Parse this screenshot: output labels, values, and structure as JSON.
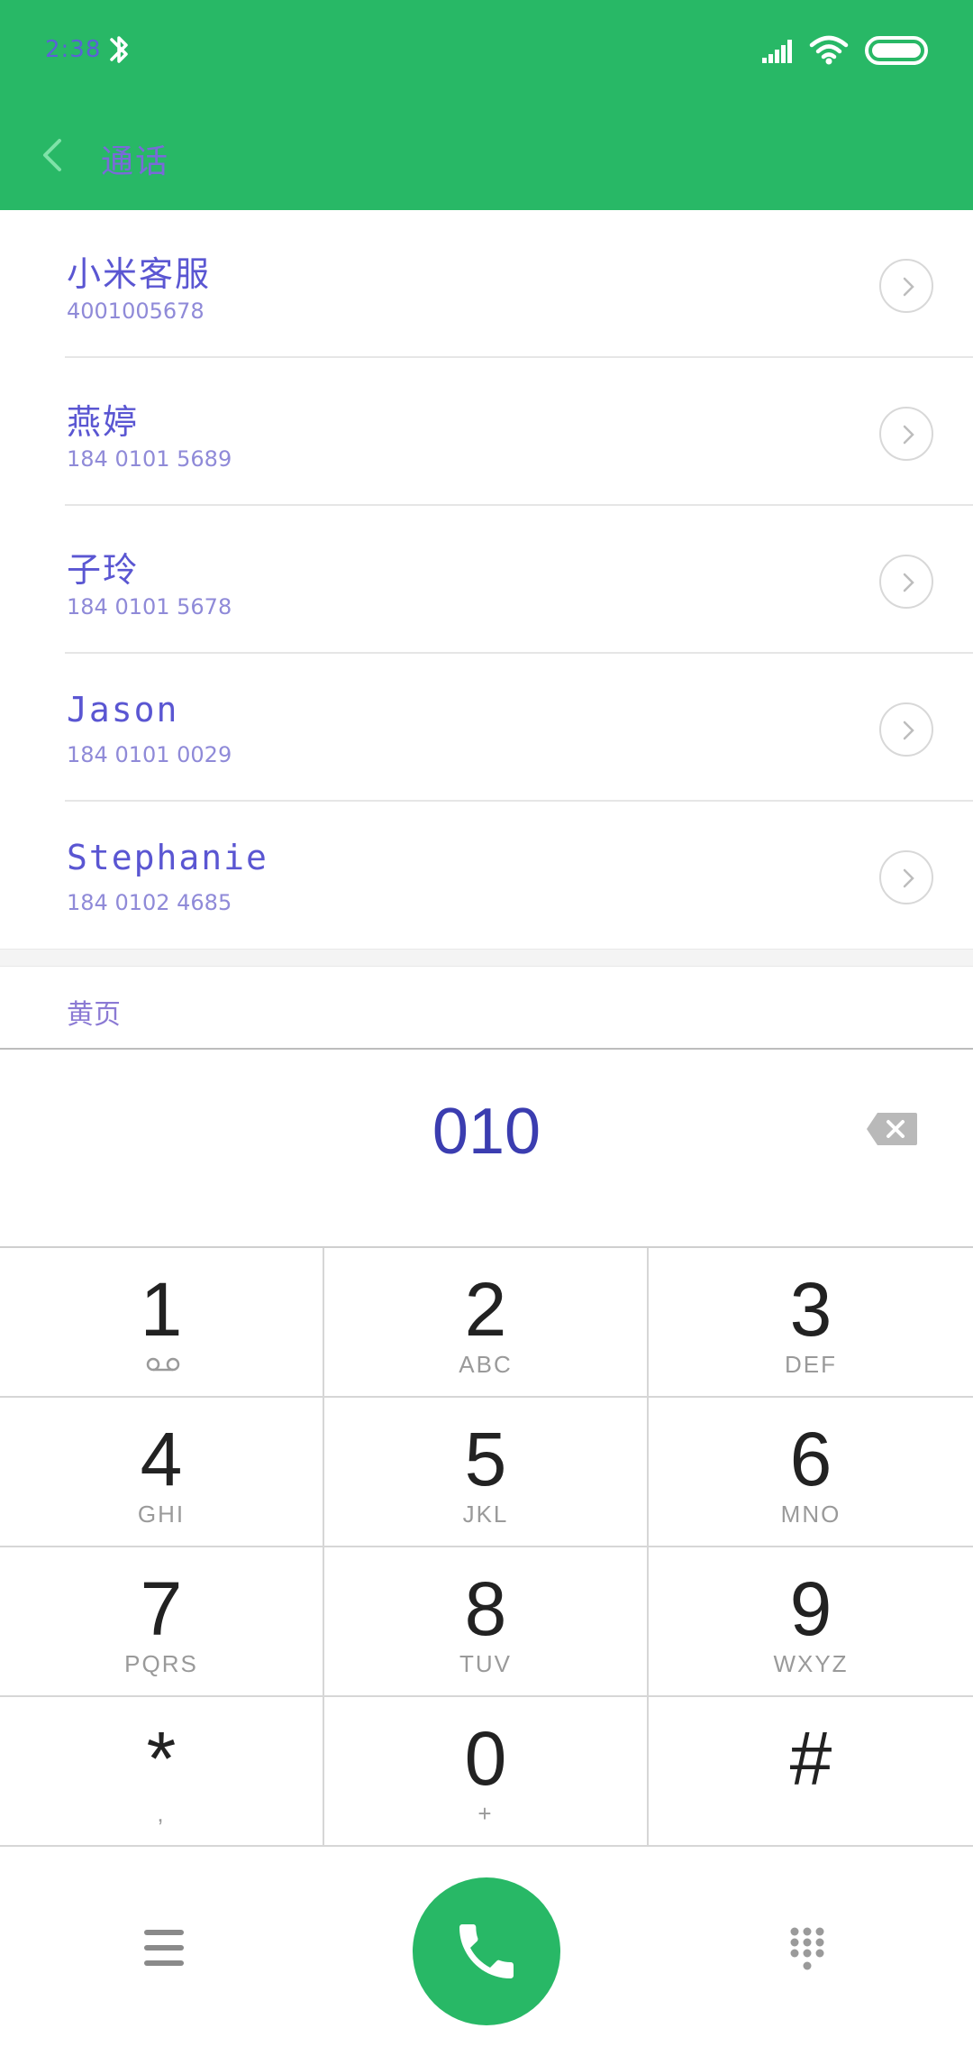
{
  "status_bar": {
    "time": "2:38"
  },
  "header": {
    "title": "通话"
  },
  "contacts": [
    {
      "name": "小米客服",
      "number": "4001005678"
    },
    {
      "name": "燕婷",
      "number": "184 0101 5689"
    },
    {
      "name": "子玲",
      "number": "184 0101 5678"
    },
    {
      "name": "Jason",
      "number": "184 0101 0029"
    },
    {
      "name": "Stephanie",
      "number": "184 0102 4685"
    }
  ],
  "yellow_pages": {
    "label": "黄页"
  },
  "dial_input": {
    "value": "010"
  },
  "keypad": [
    {
      "digit": "1",
      "letters": ""
    },
    {
      "digit": "2",
      "letters": "ABC"
    },
    {
      "digit": "3",
      "letters": "DEF"
    },
    {
      "digit": "4",
      "letters": "GHI"
    },
    {
      "digit": "5",
      "letters": "JKL"
    },
    {
      "digit": "6",
      "letters": "MNO"
    },
    {
      "digit": "7",
      "letters": "PQRS"
    },
    {
      "digit": "8",
      "letters": "TUV"
    },
    {
      "digit": "9",
      "letters": "WXYZ"
    },
    {
      "digit": "*",
      "letters": ","
    },
    {
      "digit": "0",
      "letters": "+"
    },
    {
      "digit": "#",
      "letters": ""
    }
  ],
  "colors": {
    "accent": "#28b866",
    "header_text": "#7a6ad9"
  }
}
